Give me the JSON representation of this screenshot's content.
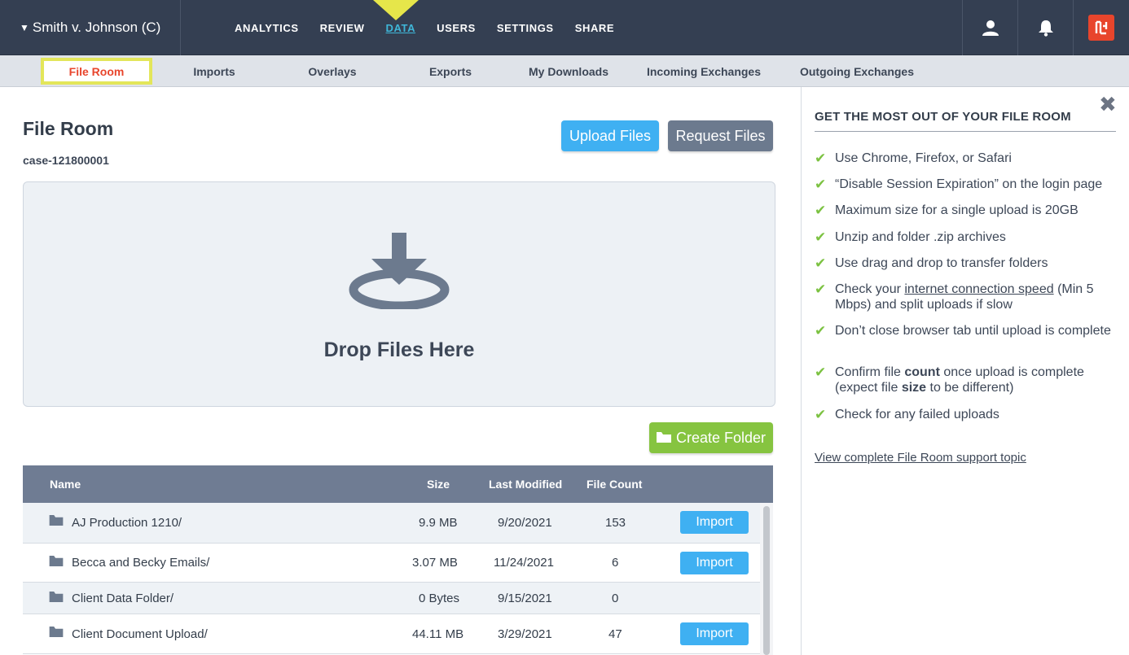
{
  "header": {
    "case_name": "Smith v. Johnson (C)",
    "nav": [
      "ANALYTICS",
      "REVIEW",
      "DATA",
      "USERS",
      "SETTINGS",
      "SHARE"
    ],
    "active_nav": "DATA",
    "accent_color": "#3fb6d8",
    "highlight_color": "#e6e64a"
  },
  "subnav": [
    "File Room",
    "Imports",
    "Overlays",
    "Exports",
    "My Downloads",
    "Incoming Exchanges",
    "Outgoing Exchanges"
  ],
  "main": {
    "title": "File Room",
    "case_id": "case-121800001",
    "upload_label": "Upload Files",
    "request_label": "Request Files",
    "drop_label": "Drop Files Here",
    "create_folder_label": "Create Folder"
  },
  "table": {
    "columns": [
      "Name",
      "Size",
      "Last Modified",
      "File Count"
    ],
    "import_label": "Import",
    "rows": [
      {
        "name": "AJ Production 1210/",
        "size": "9.9 MB",
        "modified": "9/20/2021",
        "count": "153",
        "importable": true
      },
      {
        "name": "Becca and Becky Emails/",
        "size": "3.07 MB",
        "modified": "11/24/2021",
        "count": "6",
        "importable": true
      },
      {
        "name": "Client Data Folder/",
        "size": "0 Bytes",
        "modified": "9/15/2021",
        "count": "0",
        "importable": false
      },
      {
        "name": "Client Document Upload/",
        "size": "44.11 MB",
        "modified": "3/29/2021",
        "count": "47",
        "importable": true
      }
    ]
  },
  "panel": {
    "title": "GET THE MOST OUT OF YOUR FILE ROOM",
    "tips": {
      "t1": "Use Chrome, Firefox, or Safari",
      "t2": "“Disable Session Expiration” on the login page",
      "t3": "Maximum size for a single upload is 20GB",
      "t4": "Unzip and folder .zip archives",
      "t5": "Use drag and drop to transfer folders",
      "t6_pre": "Check your ",
      "t6_link": "internet connection speed",
      "t6_post": " (Min 5 Mbps) and split uploads if slow",
      "t7": "Don’t close browser tab until upload is complete",
      "t8_pre": "Confirm file ",
      "t8_b1": "count",
      "t8_mid": " once upload is complete (expect file ",
      "t8_b2": "size",
      "t8_post": " to be different)",
      "t9": "Check for any failed uploads"
    },
    "support_link": "View complete File Room support topic",
    "check_color": "#7cc242"
  }
}
